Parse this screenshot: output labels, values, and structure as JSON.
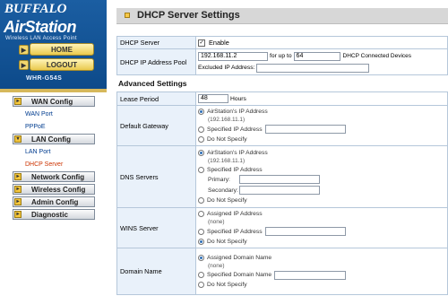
{
  "brand": {
    "logo": "BUFFALO",
    "product": "AirStation",
    "tagline": "Wireless LAN Access Point",
    "home_label": "HOME",
    "logout_label": "LOGOUT",
    "model": "WHR-G54S"
  },
  "nav": {
    "wan_config": "WAN Config",
    "wan_port": "WAN Port",
    "pppoe": "PPPoE",
    "lan_config": "LAN Config",
    "lan_port": "LAN Port",
    "dhcp_server": "DHCP Server",
    "network_config": "Network Config",
    "wireless_config": "Wireless Config",
    "admin_config": "Admin Config",
    "diagnostic": "Diagnostic"
  },
  "page": {
    "title": "DHCP Server Settings"
  },
  "dhcp": {
    "server_label": "DHCP Server",
    "enable_label": "Enable",
    "ip_pool_label": "DHCP IP Address Pool",
    "start_ip": "192.168.11.2",
    "for_up_to": "for up to",
    "count": "64",
    "connected_devices": "DHCP Connected Devices",
    "excluded_label": "Excluded IP Address:",
    "excluded_value": ""
  },
  "advanced": {
    "title": "Advanced Settings",
    "lease_label": "Lease Period",
    "lease_value": "48",
    "lease_unit": "Hours",
    "gateway": {
      "label": "Default Gateway",
      "airstation": "AirStation's IP Address",
      "airstation_ip": "(192.168.11.1)",
      "specified": "Specified IP Address",
      "specified_value": "",
      "none": "Do Not Specify"
    },
    "dns": {
      "label": "DNS Servers",
      "airstation": "AirStation's IP Address",
      "airstation_ip": "(192.168.11.1)",
      "specified": "Specified IP Address",
      "primary": "Primary:",
      "secondary": "Secondary:",
      "primary_value": "",
      "secondary_value": "",
      "none": "Do Not Specify"
    },
    "wins": {
      "label": "WINS Server",
      "assigned": "Assigned IP Address",
      "assigned_note": "(none)",
      "specified": "Specified IP Address",
      "specified_value": "",
      "none": "Do Not Specify"
    },
    "domain": {
      "label": "Domain Name",
      "assigned": "Assigned Domain Name",
      "assigned_note": "(none)",
      "specified": "Specified Domain Name",
      "specified_value": "",
      "none": "Do Not Specify"
    }
  }
}
